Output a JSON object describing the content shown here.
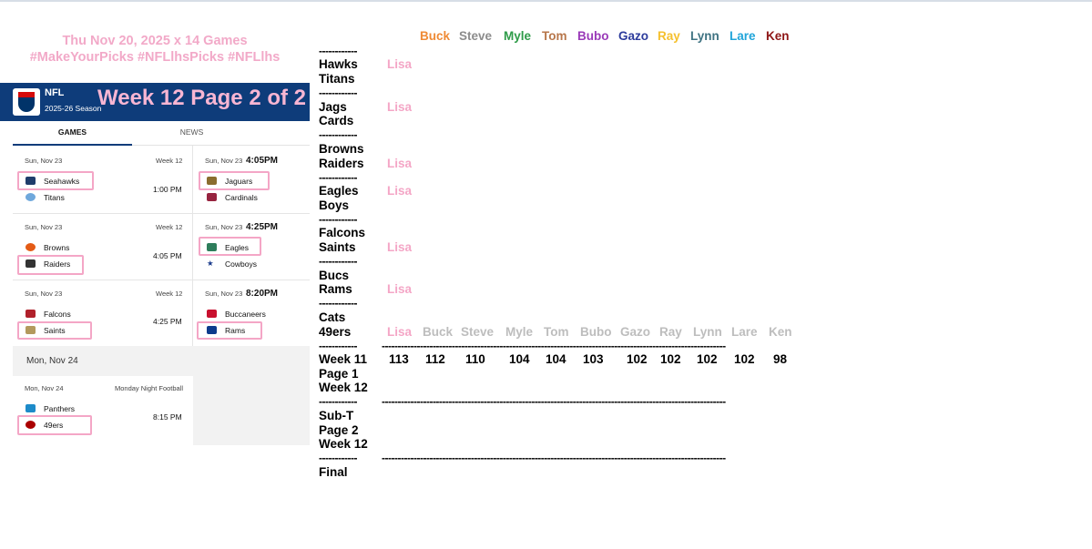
{
  "header": {
    "line1": "Thu Nov 20, 2025    x 14 Games",
    "line2": "#MakeYourPicks #NFLlhsPicks #NFLlhs"
  },
  "nfl_bar": {
    "title": "NFL",
    "season": "2025-26 Season",
    "week_title": "Week 12  Page 2 of 2"
  },
  "tabs": [
    "GAMES",
    "NEWS"
  ],
  "games": [
    {
      "date": "Sun, Nov 23",
      "week": "Week 12",
      "team1": "Seahawks",
      "team2": "Titans",
      "time": "1:00 PM",
      "pick": "team1"
    },
    {
      "date": "Sun, Nov 23",
      "big_time": "4:05PM",
      "team1": "Jaguars",
      "team2": "Cardinals",
      "pick": "team1"
    },
    {
      "date": "Sun, Nov 23",
      "week": "Week 12",
      "team1": "Browns",
      "team2": "Raiders",
      "time": "4:05 PM",
      "pick": "team2"
    },
    {
      "date": "Sun, Nov 23",
      "big_time": "4:25PM",
      "team1": "Eagles",
      "team2": "Cowboys",
      "pick": "team1"
    },
    {
      "date": "Sun, Nov 23",
      "week": "Week 12",
      "team1": "Falcons",
      "team2": "Saints",
      "time": "4:25 PM",
      "pick": "team2"
    },
    {
      "date": "Sun, Nov 23",
      "big_time": "8:20PM",
      "team1": "Buccaneers",
      "team2": "Rams",
      "pick": "team2"
    },
    {
      "date": "Mon, Nov 24",
      "week": "Monday Night Football",
      "team1": "Panthers",
      "team2": "49ers",
      "time": "8:15 PM",
      "pick": "team2"
    }
  ],
  "monday_header": "Mon, Nov 24",
  "pickers": [
    {
      "name": "Buck",
      "color": "#ef8a35"
    },
    {
      "name": "Steve",
      "color": "#8c8c8c"
    },
    {
      "name": "Myle",
      "color": "#2e9b48"
    },
    {
      "name": "Tom",
      "color": "#b7764a"
    },
    {
      "name": "Bubo",
      "color": "#9a3ab8"
    },
    {
      "name": "Gazo",
      "color": "#2c3b9c"
    },
    {
      "name": "Ray",
      "color": "#f5c02e"
    },
    {
      "name": "Lynn",
      "color": "#3f7382"
    },
    {
      "name": "Lare",
      "color": "#1fa4d9"
    },
    {
      "name": "Ken",
      "color": "#8e1616"
    }
  ],
  "separator": "------------",
  "long_separator": "------------------------------------------------------------------------------------------------------------",
  "matchups": [
    {
      "team1": "Hawks",
      "team2": "Titans",
      "pick": "Lisa"
    },
    {
      "team1": "Jags",
      "team2": "Cards",
      "pick": "Lisa"
    },
    {
      "team1": "Browns",
      "team2": "Raiders",
      "pick": "Lisa"
    },
    {
      "team1": "Eagles",
      "team2": "Boys",
      "pick": "Lisa"
    },
    {
      "team1": "Falcons",
      "team2": "Saints",
      "pick": "Lisa"
    },
    {
      "team1": "Bucs",
      "team2": "Rams",
      "pick": "Lisa"
    },
    {
      "team1": "Cats",
      "team2": "49ers",
      "pick": "Lisa"
    }
  ],
  "grey_names": [
    "Buck",
    "Steve",
    "Myle",
    "Tom",
    "Bubo",
    "Gazo",
    "Ray",
    "Lynn",
    "Lare",
    "Ken"
  ],
  "totals": {
    "label1": "Week 11",
    "label2": "Page 1",
    "label3": "Week 12",
    "scores": [
      "113",
      "112",
      "110",
      "104",
      "104",
      "103",
      "102",
      "102",
      "102",
      "102",
      "98"
    ]
  },
  "subtotal": {
    "label1": "Sub-T",
    "label2": "Page 2",
    "label3": "Week 12"
  },
  "final_label": "Final"
}
